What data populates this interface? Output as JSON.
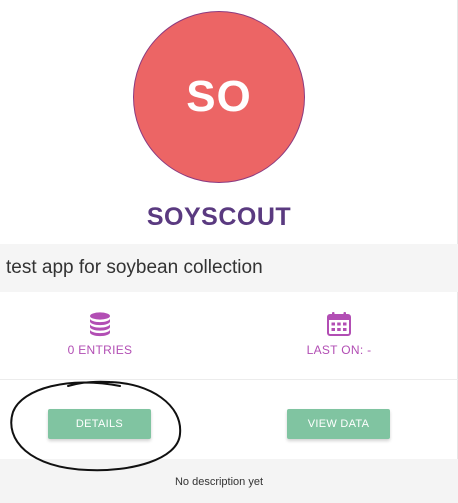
{
  "app": {
    "avatar_initials": "SO",
    "name": "SOYSCOUT",
    "description": "test app for soybean collection"
  },
  "stats": {
    "entries_label": "0 ENTRIES",
    "entries_icon": "database-icon",
    "last_on_label": "LAST ON: -",
    "last_on_icon": "calendar-icon"
  },
  "actions": {
    "details_label": "DETAILS",
    "view_data_label": "VIEW DATA"
  },
  "footer": {
    "text": "No description yet"
  },
  "colors": {
    "avatar_bg": "#ec6565",
    "app_name": "#5a3a80",
    "stat_accent": "#b24eb4",
    "button_bg": "#80c4a1"
  }
}
